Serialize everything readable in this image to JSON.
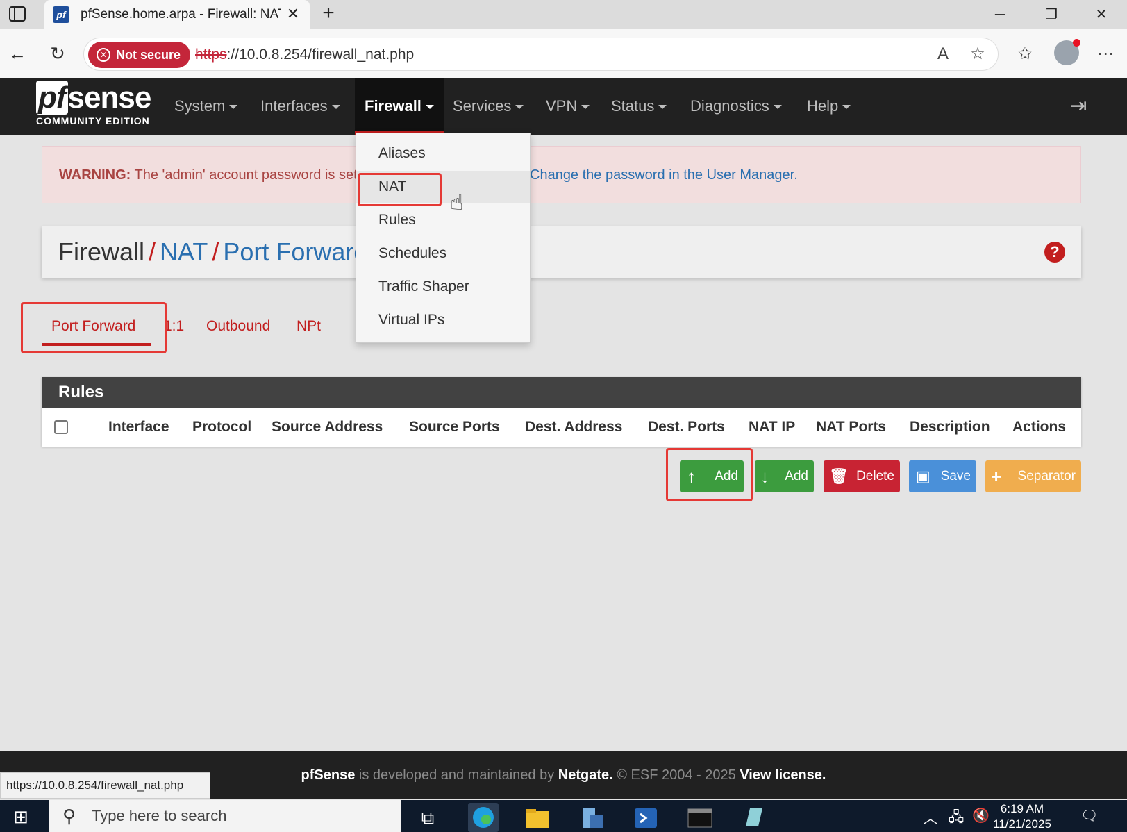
{
  "browser": {
    "tab_title": "pfSense.home.arpa - Firewall: NAT",
    "tab_favicon": "pf",
    "security_label": "Not secure",
    "url_scheme": "https",
    "url_rest": "://10.0.8.254/firewall_nat.php",
    "status_url": "https://10.0.8.254/firewall_nat.php"
  },
  "pfsense": {
    "logo_main": "sense",
    "logo_pf": "pf",
    "logo_sub": "COMMUNITY EDITION",
    "menu": [
      "System",
      "Interfaces",
      "Firewall",
      "Services",
      "VPN",
      "Status",
      "Diagnostics",
      "Help"
    ],
    "active_menu": "Firewall"
  },
  "dropdown": {
    "items": [
      "Aliases",
      "NAT",
      "Rules",
      "Schedules",
      "Traffic Shaper",
      "Virtual IPs"
    ],
    "hovered": "NAT"
  },
  "warning": {
    "label": "WARNING:",
    "text": "The 'admin' account password is set to the default value.",
    "link": "Change the password in the User Manager."
  },
  "breadcrumb": {
    "root": "Firewall",
    "sep": "/",
    "level1": "NAT",
    "level2": "Port Forward"
  },
  "nat_tabs": [
    "Port Forward",
    "1:1",
    "Outbound",
    "NPt"
  ],
  "rules": {
    "title": "Rules",
    "columns": [
      "Interface",
      "Protocol",
      "Source Address",
      "Source Ports",
      "Dest. Address",
      "Dest. Ports",
      "NAT IP",
      "NAT Ports",
      "Description",
      "Actions"
    ]
  },
  "actions": {
    "add_top": "Add",
    "add_bottom": "Add",
    "delete": "Delete",
    "save": "Save",
    "separator": "Separator"
  },
  "footer": {
    "brand": "pfSense",
    "text1": "is developed and maintained by",
    "company": "Netgate.",
    "text2": "© ESF 2004 - 2025",
    "license": "View license."
  },
  "taskbar": {
    "search_placeholder": "Type here to search",
    "time": "6:19 AM",
    "date": "11/21/2025"
  },
  "colors": {
    "accent_red": "#c21e1e",
    "link_blue": "#2a6fb0",
    "nav_bg": "#212121",
    "highlight": "#e53935"
  }
}
